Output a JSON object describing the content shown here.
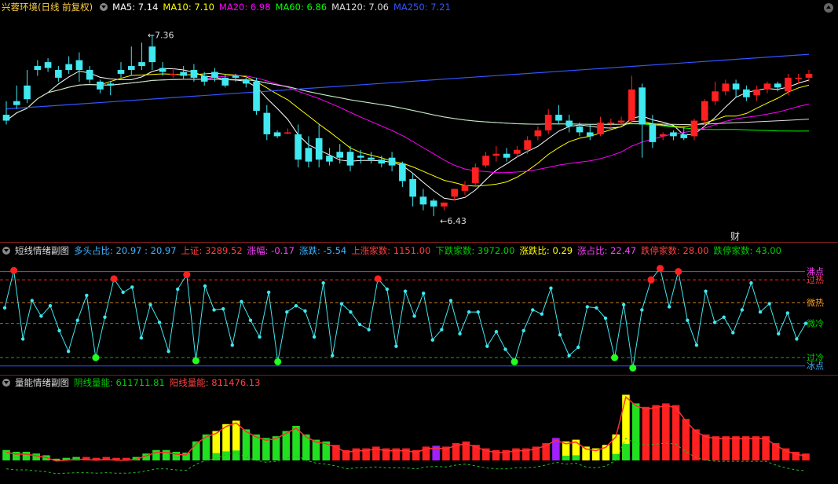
{
  "main": {
    "title": "兴蓉环境(日线 前复权)",
    "ma": [
      {
        "label": "MA5: 7.14",
        "color": "#ffffff"
      },
      {
        "label": "MA10: 7.10",
        "color": "#ffff00"
      },
      {
        "label": "MA20: 6.98",
        "color": "#ff00ff"
      },
      {
        "label": "MA60: 6.86",
        "color": "#00ff00"
      },
      {
        "label": "MA120: 7.06",
        "color": "#dddddd"
      },
      {
        "label": "MA250: 7.21",
        "color": "#3355ff"
      }
    ],
    "high_label": "7.36",
    "low_label": "6.43",
    "marker": "财"
  },
  "sub1": {
    "title": "短线情绪副图",
    "stats": [
      {
        "label": "多头占比: 20.97 : 20.97",
        "color": "#3fb4ff"
      },
      {
        "label": "上证: 3289.52",
        "color": "#ff4040"
      },
      {
        "label": "涨幅: -0.17",
        "color": "#ff40ff"
      },
      {
        "label": "涨跌: -5.54",
        "color": "#3fb4ff"
      },
      {
        "label": "上涨家数: 1151.00",
        "color": "#ff4040"
      },
      {
        "label": "下跌家数: 3972.00",
        "color": "#00d000"
      },
      {
        "label": "涨跌比: 0.29",
        "color": "#ffff00"
      },
      {
        "label": "涨占比: 22.47",
        "color": "#ff40ff"
      },
      {
        "label": "跌停家数: 28.00",
        "color": "#ff4040"
      },
      {
        "label": "跌停家数: 43.00",
        "color": "#00d000"
      }
    ],
    "levels": [
      "沸点",
      "过热",
      "微热",
      "微冷",
      "过冷",
      "冰点"
    ]
  },
  "sub2": {
    "title": "量能情绪副图",
    "stats": [
      {
        "label": "阴线量能: 611711.81",
        "color": "#00d000"
      },
      {
        "label": "阳线量能: 811476.13",
        "color": "#ff4040"
      }
    ]
  },
  "chart_data": [
    {
      "type": "candlestick",
      "title": "兴蓉环境(日线 前复权)",
      "ylim": [
        6.35,
        7.45
      ],
      "annotations": [
        {
          "text": "7.36",
          "kind": "high"
        },
        {
          "text": "6.43",
          "kind": "low"
        }
      ],
      "candles": [
        [
          6.95,
          7.02,
          6.92,
          6.9
        ],
        [
          7.02,
          7.1,
          7.0,
          6.98
        ],
        [
          7.1,
          7.18,
          7.03,
          7.01
        ],
        [
          7.2,
          7.23,
          7.18,
          7.15
        ],
        [
          7.22,
          7.24,
          7.19,
          7.17
        ],
        [
          7.18,
          7.2,
          7.14,
          7.12
        ],
        [
          7.21,
          7.25,
          7.18,
          7.16
        ],
        [
          7.23,
          7.27,
          7.18,
          7.12
        ],
        [
          7.18,
          7.2,
          7.13,
          7.11
        ],
        [
          7.12,
          7.13,
          7.08,
          7.06
        ],
        [
          7.11,
          7.12,
          7.1,
          7.05
        ],
        [
          7.18,
          7.22,
          7.16,
          7.14
        ],
        [
          7.2,
          7.3,
          7.18,
          7.15
        ],
        [
          7.22,
          7.32,
          7.2,
          7.18
        ],
        [
          7.3,
          7.36,
          7.22,
          7.18
        ],
        [
          7.19,
          7.22,
          7.17,
          7.15
        ],
        [
          7.16,
          7.19,
          7.16,
          7.14
        ],
        [
          7.17,
          7.2,
          7.15,
          7.13
        ],
        [
          7.18,
          7.21,
          7.14,
          7.12
        ],
        [
          7.15,
          7.17,
          7.12,
          7.1
        ],
        [
          7.17,
          7.19,
          7.14,
          7.12
        ],
        [
          7.14,
          7.16,
          7.1,
          7.09
        ],
        [
          7.15,
          7.16,
          7.14,
          7.12
        ],
        [
          7.13,
          7.14,
          7.11,
          7.09
        ],
        [
          7.12,
          7.14,
          6.97,
          6.95
        ],
        [
          6.96,
          7.0,
          6.85,
          6.82
        ],
        [
          6.86,
          6.87,
          6.84,
          6.83
        ],
        [
          6.86,
          6.88,
          6.86,
          6.85
        ],
        [
          6.85,
          6.9,
          6.72,
          6.68
        ],
        [
          6.78,
          6.84,
          6.71,
          6.68
        ],
        [
          6.83,
          6.9,
          6.72,
          6.68
        ],
        [
          6.74,
          6.78,
          6.71,
          6.69
        ],
        [
          6.76,
          6.8,
          6.73,
          6.7
        ],
        [
          6.76,
          6.79,
          6.69,
          6.66
        ],
        [
          6.74,
          6.77,
          6.73,
          6.7
        ],
        [
          6.73,
          6.76,
          6.72,
          6.7
        ],
        [
          6.72,
          6.74,
          6.7,
          6.68
        ],
        [
          6.73,
          6.76,
          6.69,
          6.66
        ],
        [
          6.7,
          6.71,
          6.61,
          6.58
        ],
        [
          6.62,
          6.65,
          6.53,
          6.48
        ],
        [
          6.53,
          6.57,
          6.49,
          6.46
        ],
        [
          6.51,
          6.52,
          6.48,
          6.43
        ],
        [
          6.48,
          6.5,
          6.5,
          6.46
        ],
        [
          6.53,
          6.57,
          6.57,
          6.51
        ],
        [
          6.56,
          6.61,
          6.59,
          6.54
        ],
        [
          6.6,
          6.7,
          6.68,
          6.58
        ],
        [
          6.69,
          6.76,
          6.74,
          6.68
        ],
        [
          6.74,
          6.79,
          6.75,
          6.71
        ],
        [
          6.75,
          6.78,
          6.73,
          6.71
        ],
        [
          6.75,
          6.79,
          6.77,
          6.73
        ],
        [
          6.77,
          6.84,
          6.82,
          6.75
        ],
        [
          6.84,
          6.89,
          6.87,
          6.82
        ],
        [
          6.87,
          6.98,
          6.95,
          6.85
        ],
        [
          6.95,
          7.0,
          6.92,
          6.9
        ],
        [
          6.92,
          6.95,
          6.89,
          6.86
        ],
        [
          6.89,
          6.91,
          6.86,
          6.84
        ],
        [
          6.86,
          6.9,
          6.84,
          6.82
        ],
        [
          6.85,
          6.94,
          6.91,
          6.84
        ],
        [
          6.91,
          6.93,
          6.91,
          6.89
        ],
        [
          6.91,
          6.94,
          6.92,
          6.89
        ],
        [
          6.92,
          7.15,
          7.08,
          6.91
        ],
        [
          7.09,
          7.11,
          6.9,
          6.73
        ],
        [
          6.9,
          6.95,
          6.81,
          6.78
        ],
        [
          6.84,
          6.86,
          6.85,
          6.82
        ],
        [
          6.86,
          6.87,
          6.84,
          6.82
        ],
        [
          6.85,
          6.89,
          6.83,
          6.82
        ],
        [
          6.84,
          6.93,
          6.92,
          6.82
        ],
        [
          6.92,
          7.03,
          7.02,
          6.9
        ],
        [
          7.02,
          7.12,
          7.07,
          7.0
        ],
        [
          7.07,
          7.13,
          7.11,
          7.05
        ],
        [
          7.11,
          7.13,
          7.08,
          7.04
        ],
        [
          7.08,
          7.1,
          7.04,
          7.02
        ],
        [
          7.05,
          7.1,
          7.08,
          7.02
        ],
        [
          7.08,
          7.12,
          7.11,
          7.06
        ],
        [
          7.11,
          7.12,
          7.09,
          7.07
        ],
        [
          7.07,
          7.16,
          7.14,
          7.05
        ],
        [
          7.14,
          7.16,
          7.14,
          7.11
        ],
        [
          7.14,
          7.18,
          7.16,
          7.12
        ]
      ],
      "ma_series": [
        "MA5",
        "MA10",
        "MA20",
        "MA60",
        "MA120",
        "MA250"
      ]
    },
    {
      "type": "line",
      "title": "短线情绪副图",
      "ylim": [
        0,
        100
      ],
      "y_levels": [
        {
          "name": "沸点",
          "value": 95
        },
        {
          "name": "过热",
          "value": 87
        },
        {
          "name": "微热",
          "value": 65
        },
        {
          "name": "微冷",
          "value": 45
        },
        {
          "name": "过冷",
          "value": 12
        },
        {
          "name": "冰点",
          "value": 4
        }
      ],
      "values": [
        60,
        96,
        30,
        67,
        52,
        62,
        38,
        18,
        48,
        72,
        12,
        51,
        88,
        75,
        80,
        31,
        63,
        46,
        18,
        78,
        92,
        9,
        81,
        58,
        59,
        24,
        66,
        48,
        32,
        75,
        8,
        56,
        62,
        57,
        32,
        84,
        14,
        64,
        56,
        44,
        39,
        88,
        78,
        23,
        76,
        52,
        74,
        29,
        39,
        67,
        35,
        56,
        56,
        23,
        37,
        20,
        8,
        38,
        58,
        54,
        79,
        34,
        14,
        22,
        61,
        60,
        50,
        12,
        63,
        2,
        58,
        87,
        98,
        61,
        95,
        48,
        24,
        76,
        46,
        51,
        36,
        58,
        84,
        56,
        64,
        35,
        55,
        30,
        45
      ],
      "points": {
        "red": [
          1,
          12,
          14,
          21,
          27,
          38,
          55,
          56,
          57,
          63
        ],
        "green": [
          7,
          20,
          28,
          43,
          49,
          54,
          69,
          60
        ]
      }
    },
    {
      "type": "bar",
      "title": "量能情绪副图",
      "values": [
        12,
        10,
        10,
        8,
        6,
        2,
        3,
        4,
        4,
        3,
        4,
        3,
        3,
        4,
        8,
        12,
        12,
        10,
        9,
        22,
        30,
        34,
        42,
        46,
        36,
        30,
        26,
        28,
        34,
        40,
        30,
        24,
        22,
        18,
        12,
        14,
        14,
        16,
        14,
        14,
        14,
        12,
        16,
        17,
        16,
        20,
        22,
        18,
        14,
        12,
        12,
        14,
        14,
        16,
        20,
        26,
        22,
        24,
        16,
        14,
        18,
        30,
        76,
        66,
        62,
        64,
        66,
        64,
        48,
        36,
        30,
        28,
        28,
        28,
        28,
        28,
        28,
        20,
        14,
        10,
        8
      ],
      "colors": [
        "g",
        "g",
        "g",
        "g",
        "g",
        "g",
        "g",
        "g",
        "r",
        "r",
        "r",
        "r",
        "r",
        "g",
        "g",
        "g",
        "g",
        "g",
        "g",
        "g",
        "g",
        "y",
        "y",
        "y",
        "g",
        "g",
        "g",
        "g",
        "g",
        "g",
        "g",
        "g",
        "g",
        "r",
        "r",
        "r",
        "r",
        "r",
        "r",
        "r",
        "r",
        "r",
        "r",
        "p",
        "r",
        "r",
        "r",
        "r",
        "r",
        "r",
        "r",
        "r",
        "r",
        "r",
        "r",
        "p",
        "y",
        "y",
        "y",
        "y",
        "y",
        "y",
        "y",
        "g",
        "r",
        "r",
        "r",
        "r",
        "r",
        "r",
        "r",
        "r",
        "r",
        "r",
        "r",
        "r",
        "r",
        "r",
        "r",
        "r",
        "r"
      ]
    }
  ]
}
